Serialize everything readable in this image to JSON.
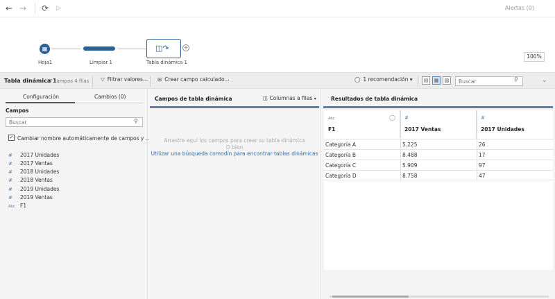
{
  "topbar": {
    "back_icon": "arrow-left-icon",
    "forward_icon": "arrow-right-icon",
    "refresh_icon": "refresh-icon",
    "run_icon": "play-icon",
    "alerts_label": "Alertas (0)"
  },
  "flow": {
    "nodes": [
      {
        "label": "Hoja1",
        "icon": "table-icon"
      },
      {
        "label": "Limpiar 1",
        "icon": "clean-step-icon"
      },
      {
        "label": "Tabla dinámica 1",
        "icon": "pivot-icon"
      }
    ],
    "add_icon": "plus-icon",
    "zoom": "100%"
  },
  "step_toolbar": {
    "title": "Tabla dinámica 1",
    "meta": "7 campos  4 filas",
    "filter_label": "Filtrar valores...",
    "calc_label": "Crear campo calculado...",
    "recommendation_label": "1 recomendación",
    "search_placeholder": "Buscar"
  },
  "left_panel": {
    "tabs": [
      "Configuración",
      "Cambios (0)"
    ],
    "fields_heading": "Campos",
    "search_placeholder": "Buscar",
    "rename_checkbox_label": "Cambiar nombre automáticamente de campos y ...",
    "rename_checked": true,
    "fields": [
      {
        "type": "#",
        "name": "2017 Unidades"
      },
      {
        "type": "#",
        "name": "2017 Ventas"
      },
      {
        "type": "#",
        "name": "2018 Unidades"
      },
      {
        "type": "#",
        "name": "2018 Ventas"
      },
      {
        "type": "#",
        "name": "2019 Unidades"
      },
      {
        "type": "#",
        "name": "2019 Ventas"
      },
      {
        "type": "Abc",
        "name": "F1"
      }
    ]
  },
  "middle_panel": {
    "heading": "Campos de tabla dinámica",
    "option_label": "Columnas a filas",
    "hint_line1": "Arrastre aquí los campos para crear su tabla dinámica",
    "hint_line2": "O bien",
    "link": "Utilizar una búsqueda comodín para encontrar tablas dinámicas"
  },
  "right_panel": {
    "heading": "Resultados de tabla dinámica",
    "columns": [
      {
        "type": "Abc",
        "name": "F1"
      },
      {
        "type": "#",
        "name": "2017 Ventas"
      },
      {
        "type": "#",
        "name": "2017 Unidades"
      }
    ],
    "rows": [
      [
        "Categoría A",
        "5.225",
        "26"
      ],
      [
        "Categoría B",
        "8.488",
        "17"
      ],
      [
        "Categoría C",
        "5.909",
        "97"
      ],
      [
        "Categoría D",
        "8.758",
        "47"
      ]
    ]
  },
  "colors": {
    "accent": "#2b5f99",
    "panel_bar": "#5a7fa8",
    "link": "#2f6ca3"
  }
}
